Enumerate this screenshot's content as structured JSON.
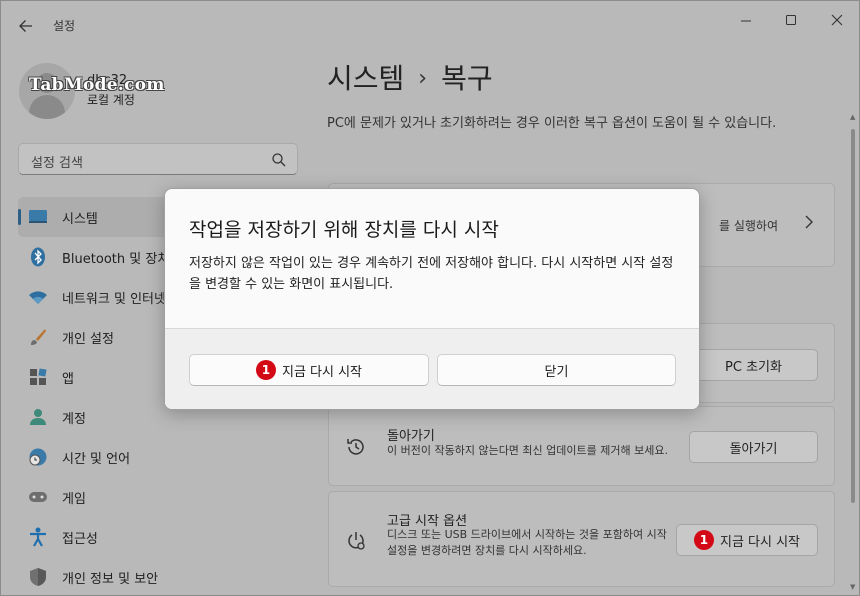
{
  "window": {
    "title": "설정"
  },
  "profile": {
    "name": "dbc32",
    "account_type": "로컬 계정",
    "watermark": "TabMode.com"
  },
  "search": {
    "placeholder": "설정 검색"
  },
  "sidebar": {
    "items": [
      {
        "label": "시스템",
        "icon": "monitor-icon",
        "active": true
      },
      {
        "label": "Bluetooth 및 장치",
        "icon": "bluetooth-icon"
      },
      {
        "label": "네트워크 및 인터넷",
        "icon": "wifi-icon"
      },
      {
        "label": "개인 설정",
        "icon": "brush-icon"
      },
      {
        "label": "앱",
        "icon": "apps-icon"
      },
      {
        "label": "계정",
        "icon": "person-icon"
      },
      {
        "label": "시간 및 언어",
        "icon": "globe-clock-icon"
      },
      {
        "label": "게임",
        "icon": "gamepad-icon"
      },
      {
        "label": "접근성",
        "icon": "accessibility-icon"
      },
      {
        "label": "개인 정보 및 보안",
        "icon": "shield-icon"
      }
    ]
  },
  "main": {
    "breadcrumb": {
      "parent": "시스템",
      "separator": "›",
      "current": "복구"
    },
    "description": "PC에 문제가 있거나 초기화하려는 경우 이러한 복구 옵션이 도움이 될 수 있습니다.",
    "card1": {
      "text": "를 실행하여"
    },
    "reset": {
      "button": "PC 초기화"
    },
    "goback": {
      "title": "돌아가기",
      "desc": "이 버전이 작동하지 않는다면 최신 업데이트를 제거해 보세요.",
      "button": "돌아가기"
    },
    "advanced": {
      "title": "고급 시작 옵션",
      "desc": "디스크 또는 USB 드라이브에서 시작하는 것을 포함하여 시작 설정을 변경하려면 장치를 다시 시작하세요.",
      "button": "지금 다시 시작",
      "badge": "1"
    }
  },
  "dialog": {
    "title": "작업을 저장하기 위해 장치를 다시 시작",
    "message": "저장하지 않은 작업이 있는 경우 계속하기 전에 저장해야 합니다. 다시 시작하면 시작 설정을 변경할 수 있는 화면이 표시됩니다.",
    "primary_button": "지금 다시 시작",
    "primary_badge": "1",
    "cancel_button": "닫기"
  },
  "colors": {
    "accent": "#2b5f86",
    "badge": "#d30a16"
  }
}
